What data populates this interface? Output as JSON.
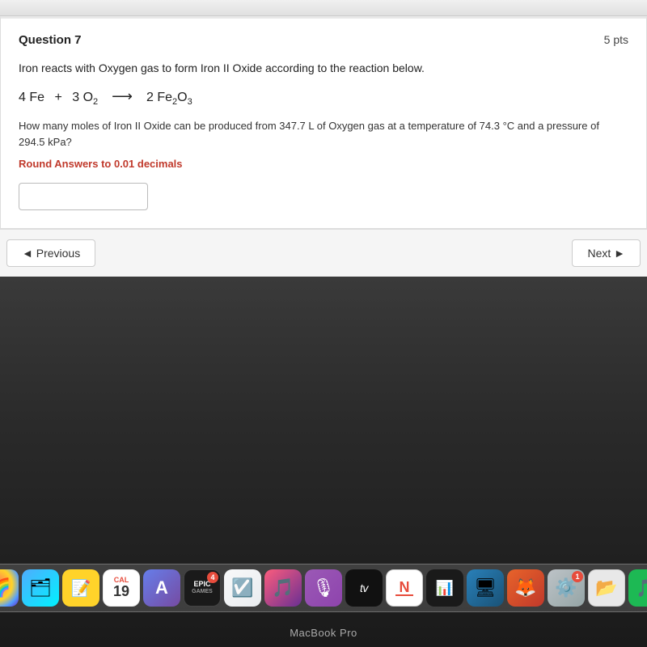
{
  "topBar": {
    "label": ""
  },
  "question": {
    "title": "Question 7",
    "points": "5 pts",
    "intro": "Iron reacts with Oxygen gas to form Iron II Oxide according to the reaction below.",
    "equation": {
      "reactant1": "4 Fe",
      "plus": "+",
      "reactant2_coef": "3 O",
      "reactant2_sub": "2",
      "arrow": "→",
      "product_coef": "2 Fe",
      "product_sub1": "2",
      "product_mid": "O",
      "product_sub2": "3"
    },
    "subQuestion": "How many moles of Iron II Oxide can be produced from 347.7 L of Oxygen gas at a temperature of 74.3 °C and a pressure of 294.5 kPa?",
    "roundNotice": "Round Answers to 0.01 decimals",
    "inputPlaceholder": ""
  },
  "navigation": {
    "previousLabel": "◄ Previous",
    "nextLabel": "Next ►"
  },
  "dock": {
    "icons": [
      {
        "name": "photos",
        "label": "",
        "emoji": "🌈",
        "class": "icon-photos"
      },
      {
        "name": "finder",
        "label": "",
        "emoji": "📁",
        "class": "icon-finder"
      },
      {
        "name": "notes",
        "label": "",
        "emoji": "📝",
        "class": "icon-notes"
      },
      {
        "name": "calendar",
        "label": "19",
        "class": "icon-calendar"
      },
      {
        "name": "launchpad",
        "label": "",
        "emoji": "A",
        "class": "icon-launchpad"
      },
      {
        "name": "epic-games",
        "label": "EPIC\nGAMES",
        "class": "icon-epic"
      },
      {
        "name": "reminders",
        "label": "",
        "emoji": "☑",
        "class": "icon-reminders"
      },
      {
        "name": "itunes",
        "label": "",
        "emoji": "♫",
        "class": "icon-itunes"
      },
      {
        "name": "podcasts",
        "label": "",
        "emoji": "🎙",
        "class": "icon-podcasts"
      },
      {
        "name": "apple-tv",
        "label": "tv",
        "class": "icon-tv"
      },
      {
        "name": "news",
        "label": "",
        "class": "icon-news"
      },
      {
        "name": "stocks",
        "label": "",
        "class": "icon-stocks"
      },
      {
        "name": "keynote",
        "label": "",
        "class": "icon-keynote"
      },
      {
        "name": "firefox",
        "label": "",
        "class": "icon-firefox"
      },
      {
        "name": "system-prefs",
        "label": "",
        "class": "icon-system-prefs"
      },
      {
        "name": "finder2",
        "label": "",
        "class": "icon-finder2"
      },
      {
        "name": "spotify",
        "label": "",
        "emoji": "🎵",
        "class": "icon-spotify"
      }
    ]
  },
  "macbook": {
    "label": "MacBook Pro"
  }
}
